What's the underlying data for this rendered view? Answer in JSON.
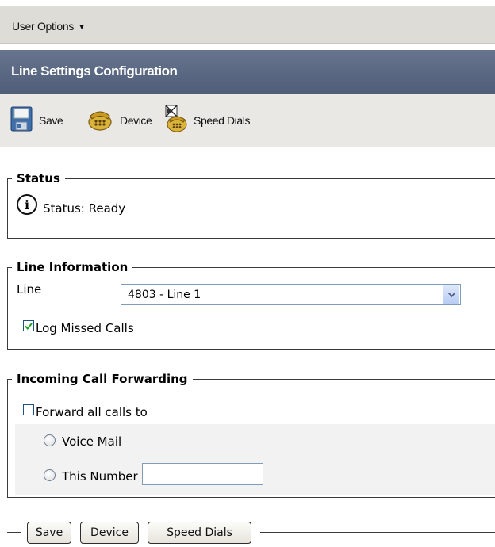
{
  "menu": {
    "user_options": "User Options"
  },
  "header": {
    "title": "Line Settings Configuration"
  },
  "toolbar": {
    "save": "Save",
    "device": "Device",
    "speed_dials": "Speed Dials"
  },
  "status": {
    "legend": "Status",
    "text": "Status: Ready"
  },
  "line_info": {
    "legend": "Line Information",
    "line_label": "Line",
    "line_selected": "4803 - Line 1",
    "log_missed_calls_label": "Log Missed Calls",
    "log_missed_calls_checked": true
  },
  "forwarding": {
    "legend": "Incoming Call Forwarding",
    "forward_all_label": "Forward all calls to",
    "forward_all_checked": false,
    "voice_mail_label": "Voice Mail",
    "this_number_label": "This Number",
    "this_number_value": ""
  },
  "buttons": {
    "save": "Save",
    "device": "Device",
    "speed_dials": "Speed Dials"
  },
  "colors": {
    "title_bar": "#56647f",
    "menu_bar": "#dedcd6",
    "toolbar": "#e9e8e4"
  }
}
